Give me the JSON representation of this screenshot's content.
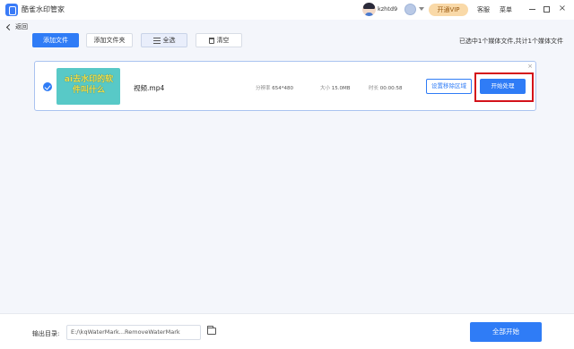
{
  "app": {
    "title": "酷雀水印管家"
  },
  "header": {
    "username": "kzhtd9",
    "vip_label": "开通VIP",
    "service_label": "客服",
    "menu_label": "菜单"
  },
  "nav": {
    "back_label": "返回"
  },
  "toolbar": {
    "add_file_label": "添加文件",
    "add_folder_label": "添加文件夹",
    "select_all_label": "全选",
    "clear_label": "清空"
  },
  "selection_info": "已选中1个媒体文件,共计1个媒体文件",
  "file": {
    "selected": true,
    "thumbnail_text": "ai去水印的软件叫什么",
    "name": "视频.mp4",
    "resolution_label": "分辨率",
    "resolution": "654*480",
    "size_label": "大小",
    "size": "15.0MB",
    "duration_label": "时长",
    "duration": "00:00:58",
    "set_region_label": "设置移除区域",
    "start_label": "开始处理"
  },
  "footer": {
    "output_label": "输出目录:",
    "output_path": "E:/\\kqWaterMark...RemoveWaterMark",
    "start_all_label": "全部开始"
  },
  "colors": {
    "accent": "#2f7cf6",
    "highlight": "#d4121a",
    "vip": "#f9d9a8"
  }
}
